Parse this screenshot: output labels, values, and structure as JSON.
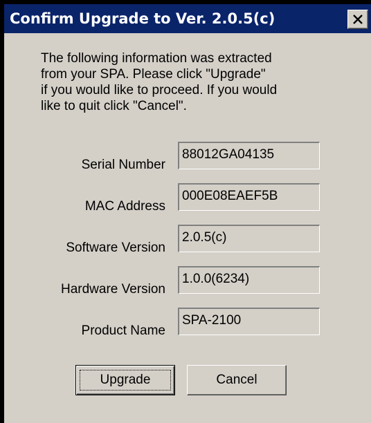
{
  "dialog": {
    "title": "Confirm Upgrade to Ver. 2.0.5(c)",
    "close_icon": "close-x-icon",
    "message": "The following information was extracted\nfrom your SPA. Please click \"Upgrade\"\nif you would like to proceed. If you would\nlike to quit click \"Cancel\".",
    "fields": [
      {
        "label": "Serial Number",
        "value": "88012GA04135"
      },
      {
        "label": "MAC Address",
        "value": "000E08EAEF5B"
      },
      {
        "label": "Software Version",
        "value": "2.0.5(c)"
      },
      {
        "label": "Hardware Version",
        "value": "1.0.0(6234)"
      },
      {
        "label": "Product Name",
        "value": "SPA-2100"
      }
    ],
    "buttons": {
      "upgrade_label": "Upgrade",
      "cancel_label": "Cancel"
    },
    "colors": {
      "titlebar": "#0a246a",
      "face": "#d4d0c8"
    }
  }
}
